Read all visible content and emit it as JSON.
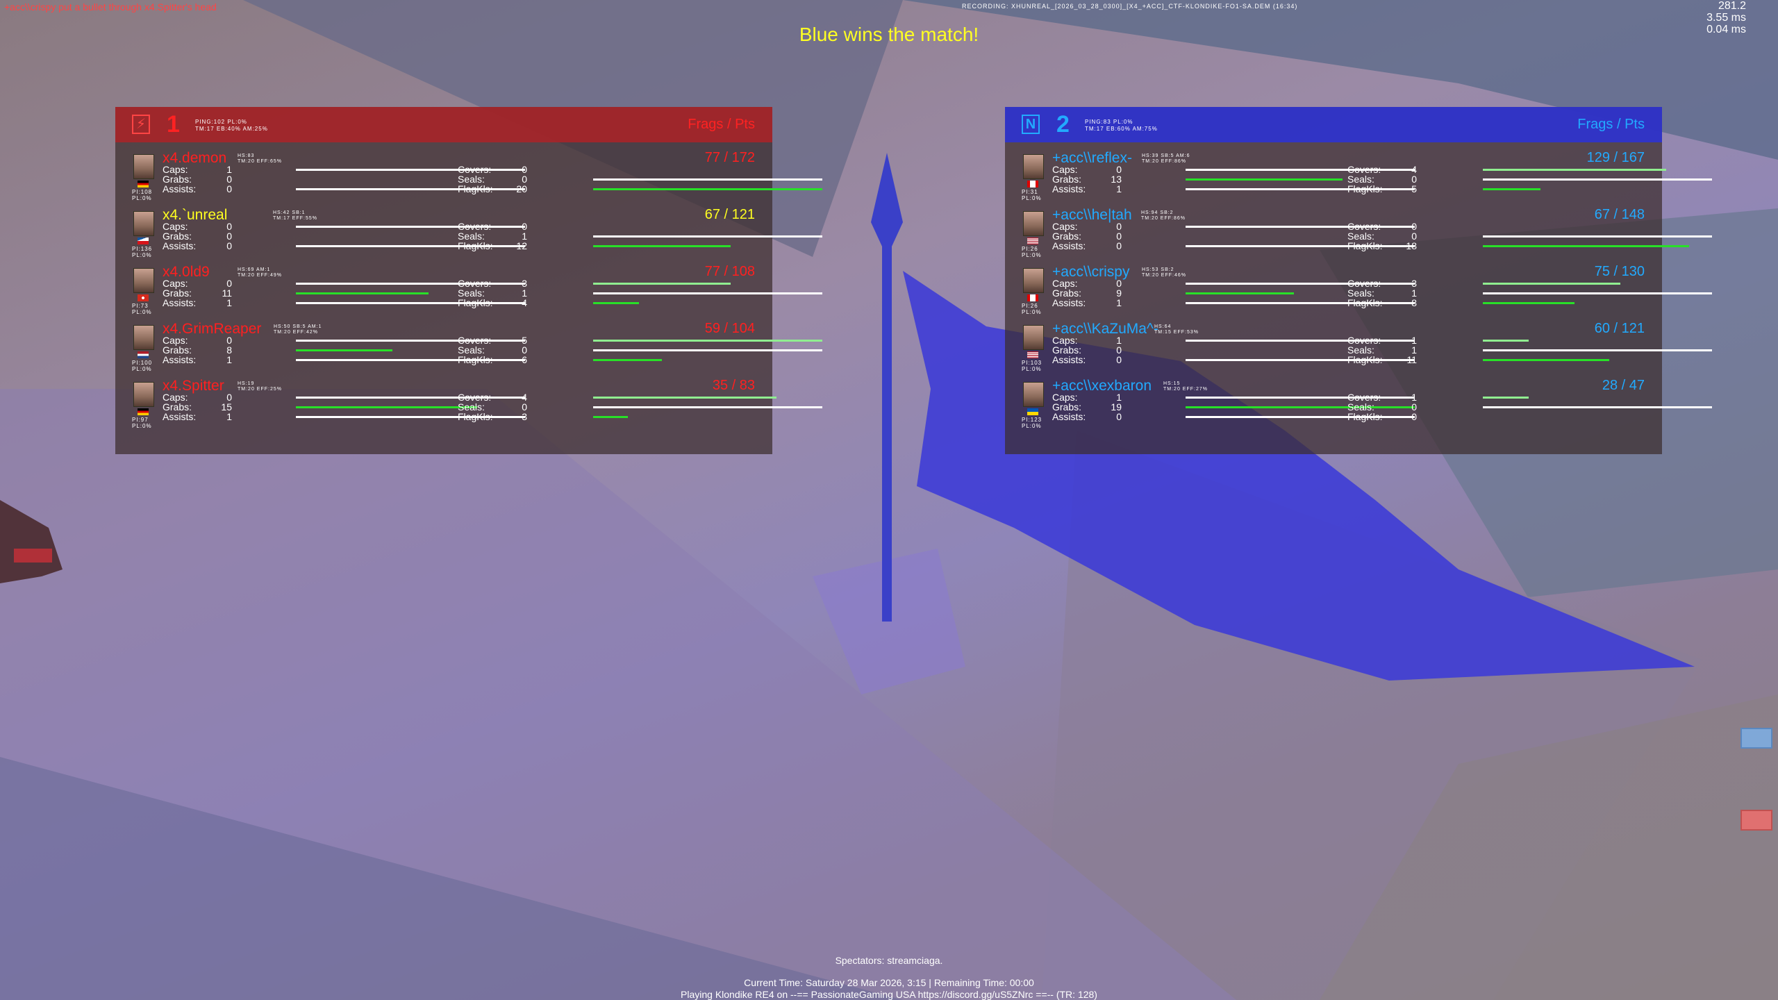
{
  "hud": {
    "kill_message": "+acc\\\\crispy put a bullet through x4.Spitter's head",
    "recording": "RECORDING: XHUNREAL_[2026_03_28_0300]_[X4_+ACC]_CTF-KLONDIKE-FO1-SA.DEM (16:34)",
    "fps": "281.2",
    "frame_ms": "3.55 ms",
    "net_ms": "0.04 ms",
    "winner": "Blue wins the match!"
  },
  "red_team": {
    "icon": "red-team-icon",
    "score": "1",
    "info_line1": "PING:102 PL:0%",
    "info_line2": "TM:17 EB:40% AM:25%",
    "header": "Frags / Pts",
    "color": "#ff2020",
    "players": [
      {
        "name": "x4.demon",
        "name_yellow": false,
        "info1": "HS:83",
        "info2": "TM:20 EFF:65%",
        "score": "77 / 172",
        "flag": "germany",
        "pi": "PI:108",
        "pl": "PL:0%",
        "caps": "1",
        "grabs": "0",
        "assists": "0",
        "covers": "0",
        "seals": "0",
        "flagkls": "20"
      },
      {
        "name": "x4.`unreal",
        "name_yellow": true,
        "info1": "HS:42 SB:1",
        "info2": "TM:17 EFF:55%",
        "score": "67 / 121",
        "flag": "czech",
        "pi": "PI:136",
        "pl": "PL:0%",
        "caps": "0",
        "grabs": "0",
        "assists": "0",
        "covers": "0",
        "seals": "1",
        "flagkls": "12"
      },
      {
        "name": "x4.0ld9",
        "name_yellow": false,
        "info1": "HS:69 AM:1",
        "info2": "TM:20 EFF:49%",
        "score": "77 / 108",
        "flag": "switzerland",
        "pi": "PI:73",
        "pl": "PL:0%",
        "caps": "0",
        "grabs": "11",
        "assists": "1",
        "covers": "3",
        "seals": "1",
        "flagkls": "4"
      },
      {
        "name": "x4.GrimReaper",
        "name_yellow": false,
        "info1": "HS:50 SB:5 AM:1",
        "info2": "TM:20 EFF:42%",
        "score": "59 / 104",
        "flag": "netherlands",
        "pi": "PI:100",
        "pl": "PL:0%",
        "caps": "0",
        "grabs": "8",
        "assists": "1",
        "covers": "5",
        "seals": "0",
        "flagkls": "6"
      },
      {
        "name": "x4.Spitter",
        "name_yellow": false,
        "info1": "HS:19",
        "info2": "TM:20 EFF:25%",
        "score": "35 / 83",
        "flag": "germany",
        "pi": "PI:97",
        "pl": "PL:0%",
        "caps": "0",
        "grabs": "15",
        "assists": "1",
        "covers": "4",
        "seals": "0",
        "flagkls": "3"
      }
    ]
  },
  "blue_team": {
    "icon": "blue-team-icon",
    "score": "2",
    "info_line1": "PING:83 PL:0%",
    "info_line2": "TM:17 EB:60% AM:75%",
    "header": "Frags / Pts",
    "color": "#22aaff",
    "players": [
      {
        "name": "+acc\\\\reflex-",
        "name_yellow": false,
        "info1": "HS:39 SB:5 AM:6",
        "info2": "TM:20 EFF:86%",
        "score": "129 / 167",
        "flag": "canada",
        "pi": "PI:31",
        "pl": "PL:0%",
        "caps": "0",
        "grabs": "13",
        "assists": "1",
        "covers": "4",
        "seals": "0",
        "flagkls": "5"
      },
      {
        "name": "+acc\\\\he|tah",
        "name_yellow": false,
        "info1": "HS:94 SB:2",
        "info2": "TM:20 EFF:86%",
        "score": "67 / 148",
        "flag": "usa",
        "pi": "PI:26",
        "pl": "PL:0%",
        "caps": "0",
        "grabs": "0",
        "assists": "0",
        "covers": "0",
        "seals": "0",
        "flagkls": "18"
      },
      {
        "name": "+acc\\\\crispy",
        "name_yellow": false,
        "info1": "HS:53 SB:2",
        "info2": "TM:20 EFF:46%",
        "score": "75 / 130",
        "flag": "canada",
        "pi": "PI:26",
        "pl": "PL:0%",
        "caps": "0",
        "grabs": "9",
        "assists": "1",
        "covers": "3",
        "seals": "1",
        "flagkls": "8"
      },
      {
        "name": "+acc\\\\KaZuMa^-",
        "name_yellow": false,
        "info1": "HS:64",
        "info2": "TM:15 EFF:53%",
        "score": "60 / 121",
        "flag": "usa",
        "pi": "PI:103",
        "pl": "PL:0%",
        "caps": "1",
        "grabs": "0",
        "assists": "0",
        "covers": "1",
        "seals": "1",
        "flagkls": "11"
      },
      {
        "name": "+acc\\\\xexbaron",
        "name_yellow": false,
        "info1": "HS:15",
        "info2": "TM:20 EFF:27%",
        "score": "28 / 47",
        "flag": "ukraine",
        "pi": "PI:123",
        "pl": "PL:0%",
        "caps": "1",
        "grabs": "19",
        "assists": "0",
        "covers": "1",
        "seals": "0",
        "flagkls": "0"
      }
    ]
  },
  "labels": {
    "caps": "Caps:",
    "grabs": "Grabs:",
    "assists": "Assists:",
    "covers": "Covers:",
    "seals": "Seals:",
    "flagkls": "FlagKls:"
  },
  "footer": {
    "spectators": "Spectators: streamciaga.",
    "time": "Current Time: Saturday 28 Mar 2026, 3:15 | Remaining Time: 00:00",
    "playing": "Playing Klondike RE4 on --== PassionateGaming USA https://discord.gg/uS5ZNrc ==-- (TR: 128)"
  }
}
